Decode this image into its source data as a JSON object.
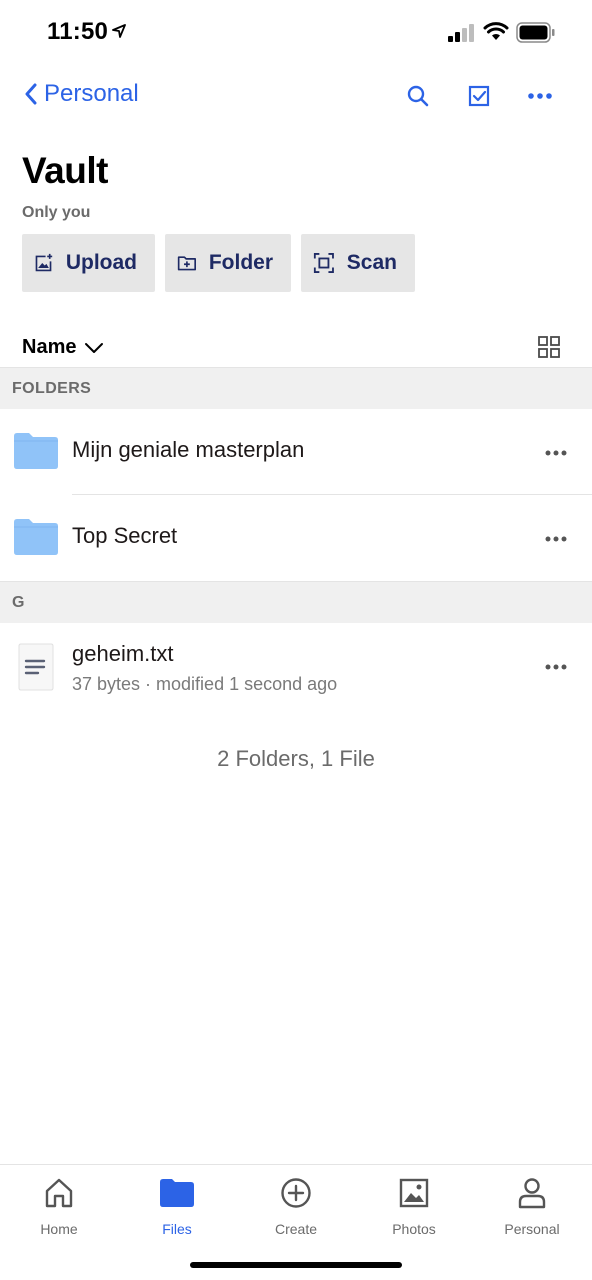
{
  "status_bar": {
    "time": "11:50"
  },
  "nav": {
    "back_label": "Personal",
    "actions": [
      "search-icon",
      "select-checkbox-icon",
      "more-icon"
    ]
  },
  "header": {
    "title": "Vault",
    "subtitle": "Only you"
  },
  "actions": {
    "upload_label": "Upload",
    "folder_label": "Folder",
    "scan_label": "Scan"
  },
  "sort": {
    "label": "Name"
  },
  "sections": {
    "folders_header": "FOLDERS",
    "files_header": "G"
  },
  "folders": [
    {
      "name": "Mijn geniale masterplan"
    },
    {
      "name": "Top Secret"
    }
  ],
  "files": [
    {
      "name": "geheim.txt",
      "meta": "37 bytes · modified 1 second ago"
    }
  ],
  "summary": "2 Folders, 1 File",
  "tabs": [
    {
      "label": "Home",
      "icon": "home-icon",
      "active": false
    },
    {
      "label": "Files",
      "icon": "folder-icon",
      "active": true
    },
    {
      "label": "Create",
      "icon": "plus-circle-icon",
      "active": false
    },
    {
      "label": "Photos",
      "icon": "photo-icon",
      "active": false
    },
    {
      "label": "Personal",
      "icon": "person-icon",
      "active": false
    }
  ],
  "colors": {
    "accent": "#2c63e6",
    "folder": "#90c3f8",
    "section_bg": "#f0f0f0",
    "button_bg": "#e6e6e6",
    "button_text": "#1e2a64"
  }
}
